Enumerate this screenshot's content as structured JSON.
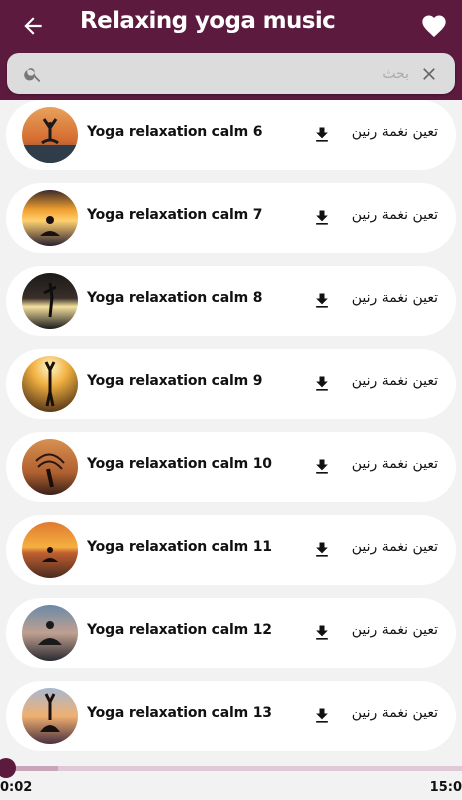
{
  "appbar": {
    "title": "Relaxing yoga music",
    "back_icon": "arrow-left-icon",
    "favorite_icon": "heart-icon",
    "color": "#5c1a3e"
  },
  "search": {
    "placeholder": "بحث",
    "value": "",
    "search_icon": "search-icon",
    "clear_icon": "close-icon"
  },
  "tracks": [
    {
      "name": "Yoga relaxation calm 6",
      "ringtone_label": "تعين نغمة رنين"
    },
    {
      "name": "Yoga relaxation calm 7",
      "ringtone_label": "تعين نغمة رنين"
    },
    {
      "name": "Yoga relaxation calm 8",
      "ringtone_label": "تعين نغمة رنين"
    },
    {
      "name": "Yoga relaxation calm 9",
      "ringtone_label": "تعين نغمة رنين"
    },
    {
      "name": "Yoga relaxation calm 10",
      "ringtone_label": "تعين نغمة رنين"
    },
    {
      "name": "Yoga relaxation calm 11",
      "ringtone_label": "تعين نغمة رنين"
    },
    {
      "name": "Yoga relaxation calm 12",
      "ringtone_label": "تعين نغمة رنين"
    },
    {
      "name": "Yoga relaxation calm 13",
      "ringtone_label": "تعين نغمة رنين"
    }
  ],
  "player": {
    "current_time": "0:02",
    "total_time": "15:0",
    "accent": "#5c1a3e"
  }
}
